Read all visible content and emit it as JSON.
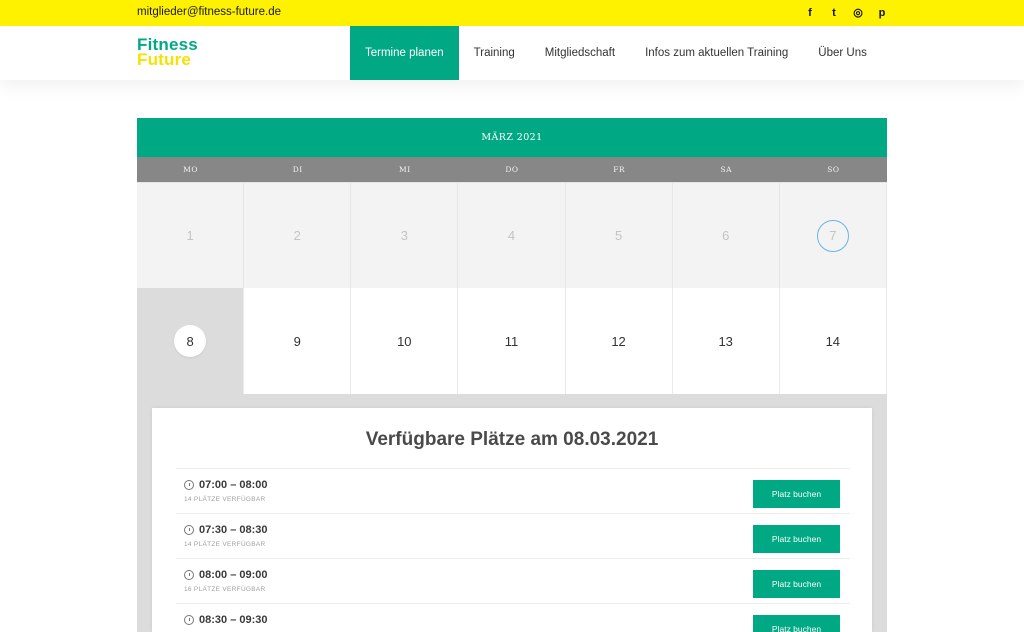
{
  "topbar": {
    "email": "mitglieder@fitness-future.de",
    "social": [
      {
        "icon": "facebook-icon",
        "glyph": "f"
      },
      {
        "icon": "twitter-icon",
        "glyph": "t"
      },
      {
        "icon": "instagram-icon",
        "glyph": "◎"
      },
      {
        "icon": "pinterest-icon",
        "glyph": "p"
      }
    ]
  },
  "logo": {
    "line1": "Fitness",
    "line2": "Future"
  },
  "nav": [
    {
      "label": "Termine planen",
      "active": true
    },
    {
      "label": "Training",
      "active": false
    },
    {
      "label": "Mitgliedschaft",
      "active": false
    },
    {
      "label": "Infos zum aktuellen Training",
      "active": false
    },
    {
      "label": "Über Uns",
      "active": false
    }
  ],
  "calendar": {
    "month": "MÄRZ 2021",
    "weekdays": [
      "MO",
      "DI",
      "MI",
      "DO",
      "FR",
      "SA",
      "SO"
    ],
    "week1": [
      "1",
      "2",
      "3",
      "4",
      "5",
      "6",
      "7"
    ],
    "week2": [
      "8",
      "9",
      "10",
      "11",
      "12",
      "13",
      "14"
    ],
    "today": "7",
    "selected": "8"
  },
  "panel": {
    "title": "Verfügbare Plätze am 08.03.2021",
    "slots": [
      {
        "time": "07:00 – 08:00",
        "availability": "14 PLÄTZE VERFÜGBAR",
        "button": "Platz buchen"
      },
      {
        "time": "07:30 – 08:30",
        "availability": "14 PLÄTZE VERFÜGBAR",
        "button": "Platz buchen"
      },
      {
        "time": "08:00 – 09:00",
        "availability": "16 PLÄTZE VERFÜGBAR",
        "button": "Platz buchen"
      },
      {
        "time": "08:30 – 09:30",
        "availability": "",
        "button": "Platz buchen"
      }
    ]
  },
  "colors": {
    "accent": "#00a884",
    "topbar": "#fff200",
    "today_ring": "#63b6e6"
  }
}
